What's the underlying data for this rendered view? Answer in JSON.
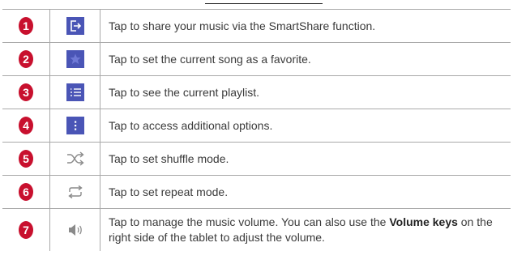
{
  "colors": {
    "badge": "#c8102e",
    "icon_bg": "#4a55b6",
    "icon_outline": "#8a8a8a",
    "rule": "#a9a9a9"
  },
  "rows": [
    {
      "number": "1",
      "icon": "share-icon",
      "text": "Tap to share your music via the SmartShare function."
    },
    {
      "number": "2",
      "icon": "favorite-star-icon",
      "text": "Tap to set the current song as a favorite."
    },
    {
      "number": "3",
      "icon": "playlist-icon",
      "text": "Tap to see the current playlist."
    },
    {
      "number": "4",
      "icon": "more-options-icon",
      "text": "Tap to access additional options."
    },
    {
      "number": "5",
      "icon": "shuffle-icon",
      "text": "Tap to set shuffle mode."
    },
    {
      "number": "6",
      "icon": "repeat-icon",
      "text": "Tap to set repeat mode."
    },
    {
      "number": "7",
      "icon": "volume-icon",
      "text_before": "Tap to manage the music volume. You can also use the ",
      "text_bold_1": "Volume",
      "text_middle": " ",
      "text_bold_2": "keys",
      "text_after": " on the right side of the tablet to adjust the volume."
    }
  ]
}
